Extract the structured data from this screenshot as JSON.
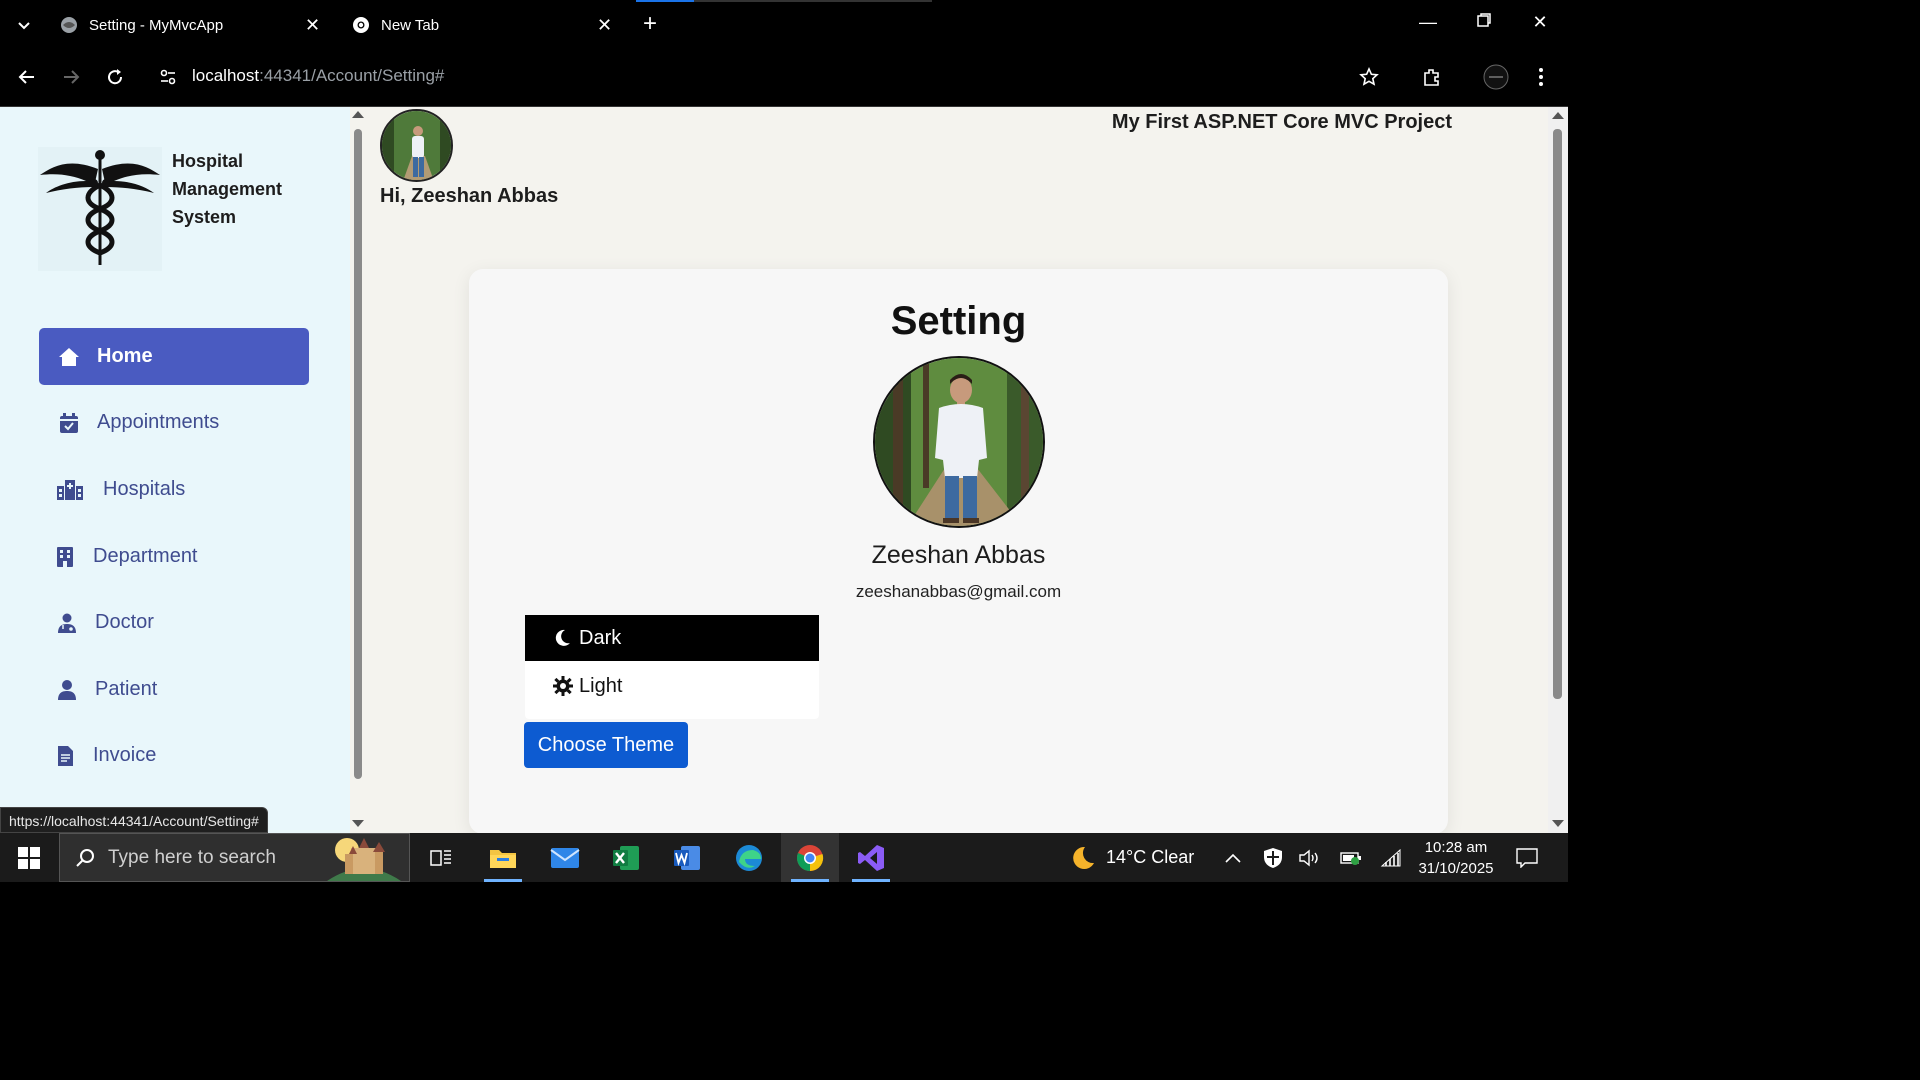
{
  "browser": {
    "tabs": [
      {
        "title": "Setting - MyMvcApp",
        "active": true
      },
      {
        "title": "New Tab",
        "active": false
      }
    ],
    "url_host": "localhost",
    "url_path": ":44341/Account/Setting#",
    "status_url": "https://localhost:44341/Account/Setting#"
  },
  "sidebar": {
    "logo_title": "Hospital Management System",
    "items": [
      {
        "label": "Home",
        "icon": "home-icon",
        "active": true
      },
      {
        "label": "Appointments",
        "icon": "calendar-check-icon",
        "active": false
      },
      {
        "label": "Hospitals",
        "icon": "hospital-icon",
        "active": false
      },
      {
        "label": "Department",
        "icon": "building-icon",
        "active": false
      },
      {
        "label": "Doctor",
        "icon": "doctor-icon",
        "active": false
      },
      {
        "label": "Patient",
        "icon": "user-icon",
        "active": false
      },
      {
        "label": "Invoice",
        "icon": "file-invoice-icon",
        "active": false
      }
    ]
  },
  "header": {
    "greeting": "Hi, Zeeshan Abbas",
    "project_title": "My First ASP.NET Core MVC Project"
  },
  "settings": {
    "title": "Setting",
    "name": "Zeeshan Abbas",
    "email": "zeeshanabbas@gmail.com",
    "theme_options": [
      {
        "label": "Dark",
        "icon": "moon-icon",
        "selected": true
      },
      {
        "label": "Light",
        "icon": "sun-gear-icon",
        "selected": false
      }
    ],
    "choose_button": "Choose Theme"
  },
  "taskbar": {
    "search_placeholder": "Type here to search",
    "weather": "14°C  Clear",
    "time": "10:28 am",
    "date": "31/10/2025",
    "apps": [
      "task-view",
      "file-explorer",
      "mail",
      "excel",
      "word",
      "edge",
      "chrome",
      "visual-studio"
    ]
  },
  "colors": {
    "sidebar_bg": "#e9f7fb",
    "active_nav": "#4a5bc1",
    "nav_text": "#3f4c8f",
    "primary_button": "#0d5bd1",
    "page_bg": "#f4f3ee"
  }
}
